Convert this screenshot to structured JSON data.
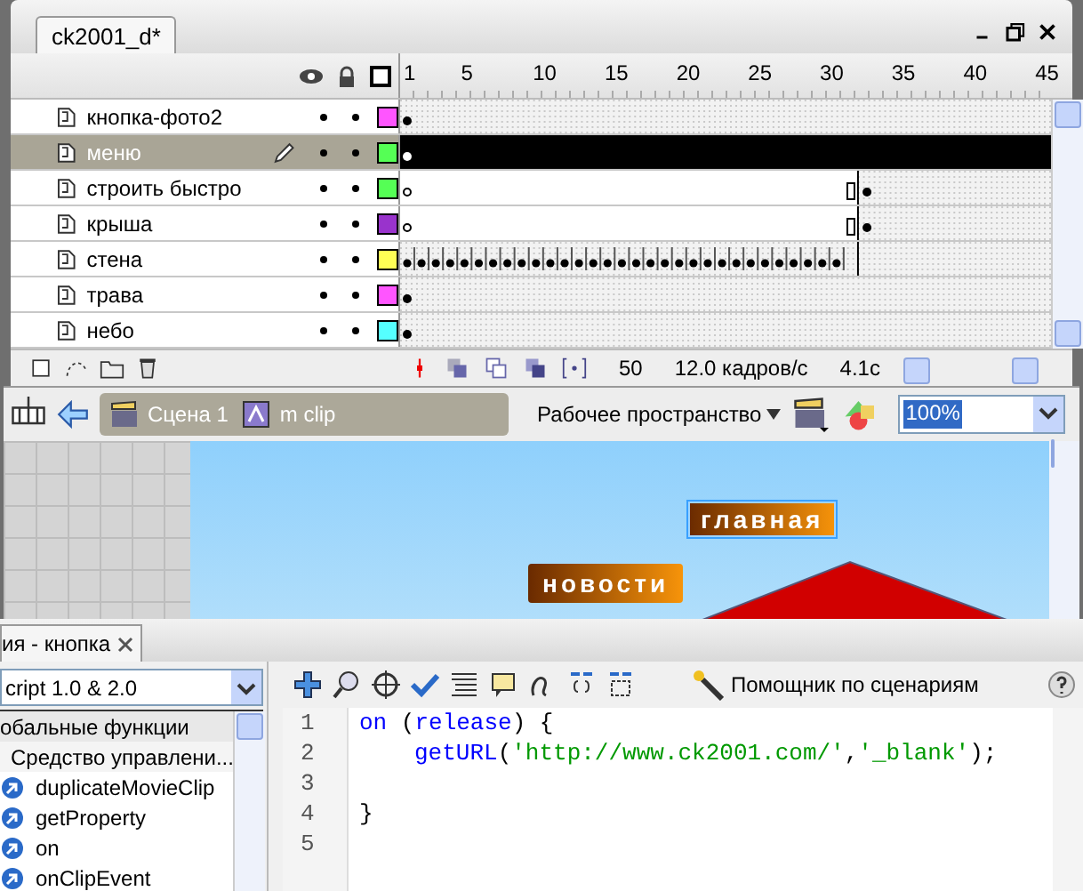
{
  "document_tab": {
    "title": "ck2001_d*"
  },
  "timeline": {
    "ruler": [
      "1",
      "5",
      "10",
      "15",
      "20",
      "25",
      "30",
      "35",
      "40",
      "45"
    ],
    "layers": [
      {
        "name": "кнопка-фото2",
        "selected": false,
        "editing": false,
        "color": "#ff55ff",
        "kind": "single"
      },
      {
        "name": "меню",
        "selected": true,
        "editing": true,
        "color": "#55ff55",
        "kind": "single"
      },
      {
        "name": "строить быстро",
        "selected": false,
        "editing": false,
        "color": "#55ff55",
        "kind": "span"
      },
      {
        "name": "крыша",
        "selected": false,
        "editing": false,
        "color": "#9933cc",
        "kind": "span"
      },
      {
        "name": "стена",
        "selected": false,
        "editing": false,
        "color": "#ffff55",
        "kind": "every"
      },
      {
        "name": "трава",
        "selected": false,
        "editing": false,
        "color": "#ff55ff",
        "kind": "single"
      },
      {
        "name": "небо",
        "selected": false,
        "editing": false,
        "color": "#55ffff",
        "kind": "single"
      }
    ],
    "current_frame": "50",
    "frame_rate": "12.0 кадров/с",
    "elapsed": "4.1с"
  },
  "edit_bar": {
    "breadcrumbs": [
      {
        "label": "Сцена 1",
        "kind": "scene"
      },
      {
        "label": "m clip",
        "kind": "symbol"
      }
    ],
    "workspace": "Рабочее пространство",
    "zoom": "100%"
  },
  "stage": {
    "buttons": [
      {
        "label": "главная",
        "selected": true
      },
      {
        "label": "новости",
        "selected": false
      }
    ]
  },
  "actions_panel": {
    "tab": "ия - кнопка",
    "version": "cript 1.0 & 2.0",
    "toolbox": [
      {
        "label": "обальные функции",
        "kind": "folder"
      },
      {
        "label": "Средство управлени...",
        "kind": "subfolder"
      },
      {
        "label": "duplicateMovieClip",
        "kind": "function"
      },
      {
        "label": "getProperty",
        "kind": "function"
      },
      {
        "label": "on",
        "kind": "function"
      },
      {
        "label": "onClipEvent",
        "kind": "function"
      }
    ],
    "assist": "Помощник по сценариям",
    "code": [
      {
        "number": "1",
        "tokens": [
          {
            "text": "on",
            "kind": "keyword"
          },
          {
            "text": " (",
            "kind": "plain"
          },
          {
            "text": "release",
            "kind": "keyword"
          },
          {
            "text": ") {",
            "kind": "plain"
          }
        ]
      },
      {
        "number": "2",
        "indented": true,
        "tokens": [
          {
            "text": "getURL",
            "kind": "keyword"
          },
          {
            "text": "(",
            "kind": "plain"
          },
          {
            "text": "'http://www.ck2001.com/'",
            "kind": "string"
          },
          {
            "text": ",",
            "kind": "plain"
          },
          {
            "text": "'_blank'",
            "kind": "string"
          },
          {
            "text": ");",
            "kind": "plain"
          }
        ]
      },
      {
        "number": "3"
      },
      {
        "number": "4",
        "tokens": [
          {
            "text": "}",
            "kind": "plain"
          }
        ]
      },
      {
        "number": "5"
      }
    ]
  }
}
